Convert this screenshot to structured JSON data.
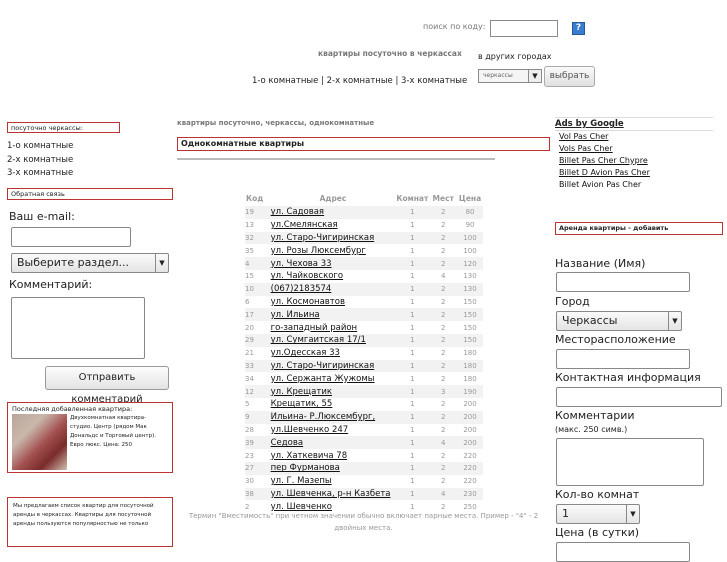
{
  "header": {
    "search_label": "поиск по коду:",
    "search_value": "",
    "help_label": "?",
    "site_title": "квартиры посуточно в черкассах",
    "other_cities_label": "в других городах",
    "city_select_value": "черкассы",
    "choose_button": "выбрать",
    "room_links": "1-о комнатные | 2-х комнатные | 3-х комнатные"
  },
  "left": {
    "section_title": "посуточно черкассы:",
    "rooms": [
      "1-о комнатные",
      "2-х комнатные",
      "3-х комнатные"
    ],
    "feedback_title": "Обратная связь",
    "email_label": "Ваш e-mail:",
    "section_select": "Выберите раздел...",
    "comment_label": "Комментарий:",
    "send_button": "Отправить комментарий",
    "last_apartment_title": "Последняя добавленная квартира:",
    "last_apartment_desc": "Двухкомнатная квартира-студио. Центр (рядом Мак Дональдс и Торговый центр). Евро люкс. Цена: 250",
    "offer_text": "Мы предлагаем список квартир для посуточной аренды в черкассах. Квартиры для посуточной аренды пользуются популярностью не только"
  },
  "center": {
    "breadcrumb": "квартиры посуточно, черкассы, однокомнатные",
    "heading": "Однокомнатные квартиры",
    "columns": [
      "Код",
      "Адрес",
      "Комнат",
      "Мест",
      "Цена"
    ],
    "rows": [
      {
        "code": "19",
        "address": "ул. Садовая",
        "rooms": "1",
        "beds": "2",
        "price": "80"
      },
      {
        "code": "13",
        "address": "ул.Смелянская",
        "rooms": "1",
        "beds": "2",
        "price": "90"
      },
      {
        "code": "32",
        "address": "ул. Старо-Чигиринская",
        "rooms": "1",
        "beds": "2",
        "price": "100"
      },
      {
        "code": "35",
        "address": "ул. Розы Люксембург",
        "rooms": "1",
        "beds": "2",
        "price": "100"
      },
      {
        "code": "4",
        "address": "ул. Чехова 33",
        "rooms": "1",
        "beds": "2",
        "price": "120"
      },
      {
        "code": "15",
        "address": "ул. Чайковского",
        "rooms": "1",
        "beds": "4",
        "price": "130"
      },
      {
        "code": "10",
        "address": "(067)2183574",
        "rooms": "1",
        "beds": "2",
        "price": "130"
      },
      {
        "code": "6",
        "address": "ул. Космонавтов",
        "rooms": "1",
        "beds": "2",
        "price": "150"
      },
      {
        "code": "17",
        "address": "ул. Ильина",
        "rooms": "1",
        "beds": "2",
        "price": "150"
      },
      {
        "code": "20",
        "address": "го-западный район",
        "rooms": "1",
        "beds": "2",
        "price": "150"
      },
      {
        "code": "29",
        "address": "ул. Сумгаитская 17/1",
        "rooms": "1",
        "beds": "2",
        "price": "150"
      },
      {
        "code": "21",
        "address": "ул.Одесская 33",
        "rooms": "1",
        "beds": "2",
        "price": "180"
      },
      {
        "code": "33",
        "address": "ул. Старо-Чигиринская",
        "rooms": "1",
        "beds": "2",
        "price": "180"
      },
      {
        "code": "34",
        "address": "ул. Сержанта Жужомы",
        "rooms": "1",
        "beds": "2",
        "price": "180"
      },
      {
        "code": "12",
        "address": "ул. Крещатик",
        "rooms": "1",
        "beds": "3",
        "price": "190"
      },
      {
        "code": "5",
        "address": "Крещатик, 55",
        "rooms": "1",
        "beds": "2",
        "price": "200"
      },
      {
        "code": "9",
        "address": "Ильина- Р.Люксембург,",
        "rooms": "1",
        "beds": "2",
        "price": "200"
      },
      {
        "code": "28",
        "address": "ул.Шевченко 247",
        "rooms": "1",
        "beds": "2",
        "price": "200"
      },
      {
        "code": "39",
        "address": "Седова",
        "rooms": "1",
        "beds": "4",
        "price": "200"
      },
      {
        "code": "23",
        "address": "ул. Хаткевича 78",
        "rooms": "1",
        "beds": "2",
        "price": "220"
      },
      {
        "code": "27",
        "address": "пер Фурманова",
        "rooms": "1",
        "beds": "2",
        "price": "220"
      },
      {
        "code": "30",
        "address": "ул. Г. Мазепы",
        "rooms": "1",
        "beds": "2",
        "price": "220"
      },
      {
        "code": "38",
        "address": "ул. Шевченка, р-н Казбета",
        "rooms": "1",
        "beds": "4",
        "price": "230"
      },
      {
        "code": "2",
        "address": "ул. Шевченко",
        "rooms": "1",
        "beds": "2",
        "price": "250"
      }
    ],
    "footnote": "Термин \"Вместимость\" при четном значении обычно включает парные места. Пример - \"4\" - 2 двойных места."
  },
  "right": {
    "ads_title": "Ads by Google",
    "ads": [
      "Vol Pas Cher",
      "Vols Pas Cher",
      "Billet Pas Cher Chypre",
      "Billet D Avion Pas Cher",
      "Billet Avion Pas Cher"
    ],
    "add_title": "Аренда квартиры - добавить",
    "name_label": "Название (Имя)",
    "city_label": "Город",
    "city_value": "Черкассы",
    "location_label": "Месторасположение",
    "contact_label": "Контактная информация",
    "comments_label": "Комментарии",
    "comments_hint": "(макс. 250 симв.)",
    "rooms_label": "Кол-во комнат",
    "rooms_value": "1",
    "price_label": "Цена (в сутки)"
  }
}
